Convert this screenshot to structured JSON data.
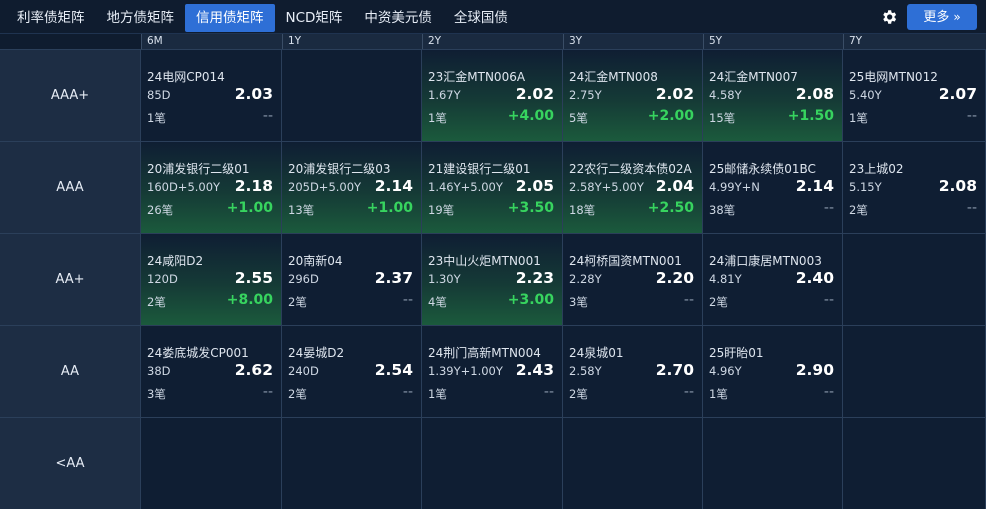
{
  "tabs": [
    {
      "label": "利率债矩阵",
      "active": false
    },
    {
      "label": "地方债矩阵",
      "active": false
    },
    {
      "label": "信用债矩阵",
      "active": true
    },
    {
      "label": "NCD矩阵",
      "active": false
    },
    {
      "label": "中资美元债",
      "active": false
    },
    {
      "label": "全球国债",
      "active": false
    }
  ],
  "toolbar": {
    "settings_icon": "gear-icon",
    "more_label": "更多",
    "more_icon": "double-chevron-right-icon"
  },
  "columns": [
    "6M",
    "1Y",
    "2Y",
    "3Y",
    "5Y",
    "7Y"
  ],
  "rows": [
    "AAA+",
    "AAA",
    "AA+",
    "AA",
    "<AA"
  ],
  "colors": {
    "accent": "#2e6fd6",
    "up": "#37d45f"
  },
  "cells": [
    [
      {
        "name": "24电网CP014",
        "term": "85D",
        "rate": "2.03",
        "count": "1笔",
        "change": "--",
        "up": false
      },
      null,
      {
        "name": "23汇金MTN006A",
        "term": "1.67Y",
        "rate": "2.02",
        "count": "1笔",
        "change": "+4.00",
        "up": true
      },
      {
        "name": "24汇金MTN008",
        "term": "2.75Y",
        "rate": "2.02",
        "count": "5笔",
        "change": "+2.00",
        "up": true
      },
      {
        "name": "24汇金MTN007",
        "term": "4.58Y",
        "rate": "2.08",
        "count": "15笔",
        "change": "+1.50",
        "up": true
      },
      {
        "name": "25电网MTN012",
        "term": "5.40Y",
        "rate": "2.07",
        "count": "1笔",
        "change": "--",
        "up": false
      }
    ],
    [
      {
        "name": "20浦发银行二级01",
        "term": "160D+5.00Y",
        "rate": "2.18",
        "count": "26笔",
        "change": "+1.00",
        "up": true
      },
      {
        "name": "20浦发银行二级03",
        "term": "205D+5.00Y",
        "rate": "2.14",
        "count": "13笔",
        "change": "+1.00",
        "up": true
      },
      {
        "name": "21建设银行二级01",
        "term": "1.46Y+5.00Y",
        "rate": "2.05",
        "count": "19笔",
        "change": "+3.50",
        "up": true
      },
      {
        "name": "22农行二级资本债02A",
        "term": "2.58Y+5.00Y",
        "rate": "2.04",
        "count": "18笔",
        "change": "+2.50",
        "up": true
      },
      {
        "name": "25邮储永续债01BC",
        "term": "4.99Y+N",
        "rate": "2.14",
        "count": "38笔",
        "change": "--",
        "up": false
      },
      {
        "name": "23上城02",
        "term": "5.15Y",
        "rate": "2.08",
        "count": "2笔",
        "change": "--",
        "up": false
      }
    ],
    [
      {
        "name": "24咸阳D2",
        "term": "120D",
        "rate": "2.55",
        "count": "2笔",
        "change": "+8.00",
        "up": true
      },
      {
        "name": "20南新04",
        "term": "296D",
        "rate": "2.37",
        "count": "2笔",
        "change": "--",
        "up": false
      },
      {
        "name": "23中山火炬MTN001",
        "term": "1.30Y",
        "rate": "2.23",
        "count": "4笔",
        "change": "+3.00",
        "up": true
      },
      {
        "name": "24柯桥国资MTN001",
        "term": "2.28Y",
        "rate": "2.20",
        "count": "3笔",
        "change": "--",
        "up": false
      },
      {
        "name": "24浦口康居MTN003",
        "term": "4.81Y",
        "rate": "2.40",
        "count": "2笔",
        "change": "--",
        "up": false
      },
      null
    ],
    [
      {
        "name": "24娄底城发CP001",
        "term": "38D",
        "rate": "2.62",
        "count": "3笔",
        "change": "--",
        "up": false
      },
      {
        "name": "24晏城D2",
        "term": "240D",
        "rate": "2.54",
        "count": "2笔",
        "change": "--",
        "up": false
      },
      {
        "name": "24荆门高新MTN004",
        "term": "1.39Y+1.00Y",
        "rate": "2.43",
        "count": "1笔",
        "change": "--",
        "up": false
      },
      {
        "name": "24泉城01",
        "term": "2.58Y",
        "rate": "2.70",
        "count": "2笔",
        "change": "--",
        "up": false
      },
      {
        "name": "25盱眙01",
        "term": "4.96Y",
        "rate": "2.90",
        "count": "1笔",
        "change": "--",
        "up": false
      },
      null
    ],
    [
      null,
      null,
      null,
      null,
      null,
      null
    ]
  ]
}
